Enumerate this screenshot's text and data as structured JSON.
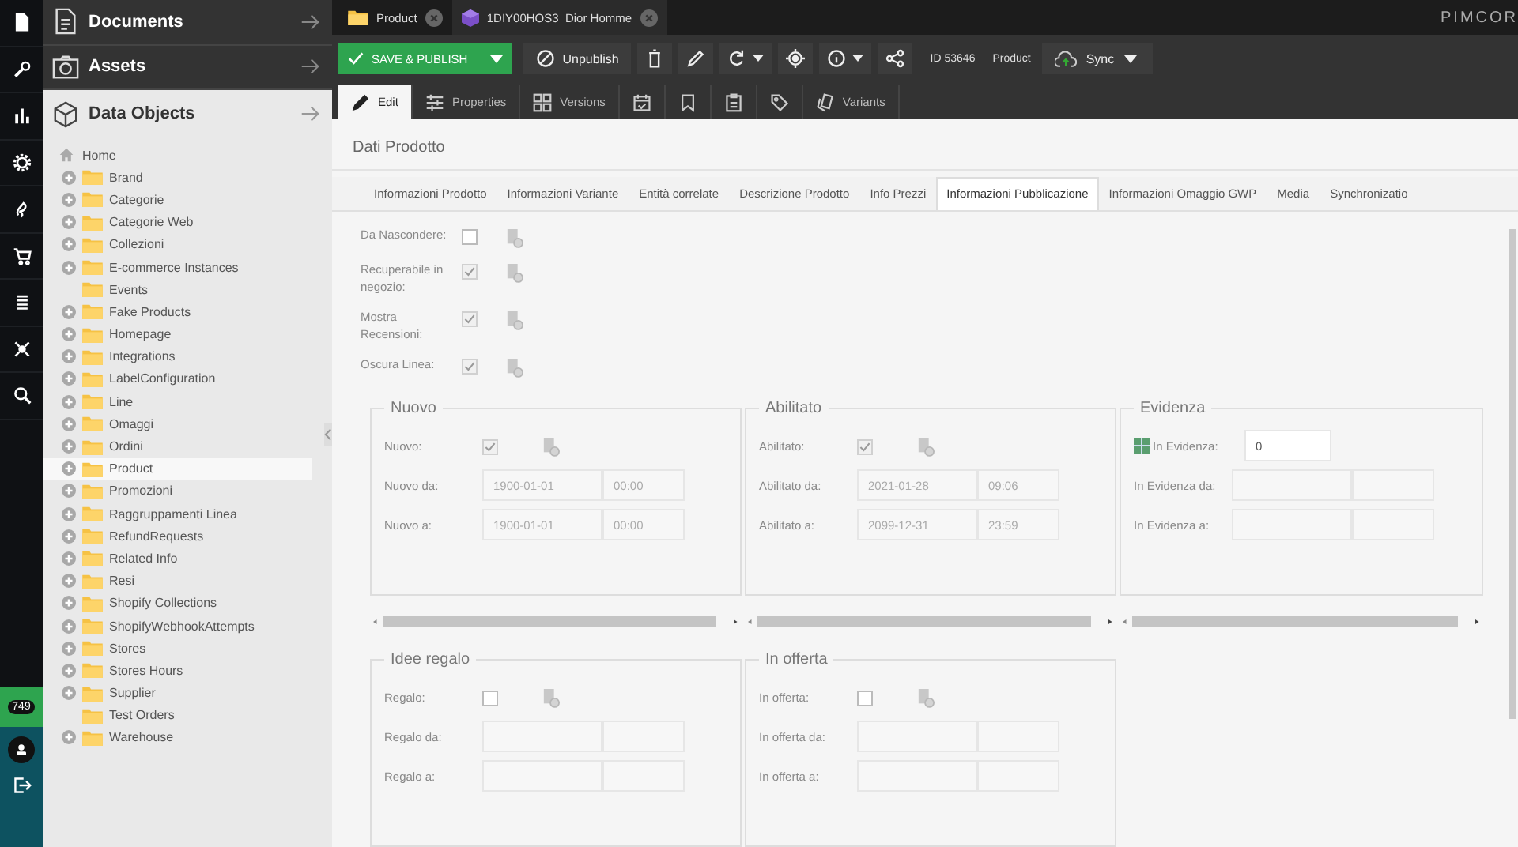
{
  "left_bar": {
    "badge": "749"
  },
  "sidebar": {
    "panels": [
      {
        "title": "Documents",
        "expanded": false
      },
      {
        "title": "Assets",
        "expanded": false
      },
      {
        "title": "Data Objects",
        "expanded": true
      }
    ],
    "tree": {
      "label": "Home",
      "children": [
        {
          "label": "Brand",
          "expandable": true,
          "selected": false
        },
        {
          "label": "Categorie",
          "expandable": true,
          "selected": false
        },
        {
          "label": "Categorie Web",
          "expandable": true,
          "selected": false
        },
        {
          "label": "Collezioni",
          "expandable": true,
          "selected": false
        },
        {
          "label": "E-commerce Instances",
          "expandable": true,
          "selected": false
        },
        {
          "label": "Events",
          "expandable": false,
          "selected": false
        },
        {
          "label": "Fake Products",
          "expandable": true,
          "selected": false
        },
        {
          "label": "Homepage",
          "expandable": true,
          "selected": false
        },
        {
          "label": "Integrations",
          "expandable": true,
          "selected": false
        },
        {
          "label": "LabelConfiguration",
          "expandable": true,
          "selected": false
        },
        {
          "label": "Line",
          "expandable": true,
          "selected": false
        },
        {
          "label": "Omaggi",
          "expandable": true,
          "selected": false
        },
        {
          "label": "Ordini",
          "expandable": true,
          "selected": false
        },
        {
          "label": "Product",
          "expandable": true,
          "selected": true
        },
        {
          "label": "Promozioni",
          "expandable": true,
          "selected": false
        },
        {
          "label": "Raggruppamenti Linea",
          "expandable": true,
          "selected": false
        },
        {
          "label": "RefundRequests",
          "expandable": true,
          "selected": false
        },
        {
          "label": "Related Info",
          "expandable": true,
          "selected": false
        },
        {
          "label": "Resi",
          "expandable": true,
          "selected": false
        },
        {
          "label": "Shopify Collections",
          "expandable": true,
          "selected": false
        },
        {
          "label": "ShopifyWebhookAttempts",
          "expandable": true,
          "selected": false
        },
        {
          "label": "Stores",
          "expandable": true,
          "selected": false
        },
        {
          "label": "Stores Hours",
          "expandable": true,
          "selected": false
        },
        {
          "label": "Supplier",
          "expandable": true,
          "selected": false
        },
        {
          "label": "Test Orders",
          "expandable": false,
          "selected": false
        },
        {
          "label": "Warehouse",
          "expandable": true,
          "selected": false
        }
      ]
    }
  },
  "editor_tabs": [
    {
      "label": "Product",
      "kind": "folder",
      "selected": false
    },
    {
      "label": "1DIY00HOS3_Dior Homme",
      "kind": "object",
      "selected": true
    }
  ],
  "logo": "PIMCOR",
  "toolbar": {
    "save_label": "SAVE & PUBLISH",
    "unpublish_label": "Unpublish",
    "id": "ID 53646",
    "type": "Product",
    "sync_label": "Sync"
  },
  "view_tabs": [
    {
      "label": "Edit",
      "selected": true
    },
    {
      "label": "Properties",
      "selected": false
    },
    {
      "label": "Versions",
      "selected": false
    },
    {
      "selected": false
    },
    {
      "selected": false
    },
    {
      "selected": false
    },
    {
      "selected": false
    },
    {
      "label": "Variants",
      "selected": false
    }
  ],
  "panel_title": "Dati Prodotto",
  "form_tabs": [
    {
      "label": "Informazioni Prodotto",
      "selected": false
    },
    {
      "label": "Informazioni Variante",
      "selected": false
    },
    {
      "label": "Entità correlate",
      "selected": false
    },
    {
      "label": "Descrizione Prodotto",
      "selected": false
    },
    {
      "label": "Info Prezzi",
      "selected": false
    },
    {
      "label": "Informazioni Pubblicazione",
      "selected": true
    },
    {
      "label": "Informazioni Omaggio GWP",
      "selected": false
    },
    {
      "label": "Media",
      "selected": false
    },
    {
      "label": "Synchronizatio",
      "selected": false
    }
  ],
  "flags": [
    {
      "label": "Da Nascondere:",
      "checked": false
    },
    {
      "label": "Recuperabile in negozio:",
      "checked": true
    },
    {
      "label": "Mostra Recensioni:",
      "checked": true
    },
    {
      "label": "Oscura Linea:",
      "checked": true
    }
  ],
  "fieldset_rows": [
    [
      {
        "title": "Nuovo",
        "rows": [
          {
            "kind": "checkbox",
            "label": "Nuovo:",
            "checked": true
          },
          {
            "kind": "datetime",
            "label": "Nuovo da:",
            "date": "1900-01-01",
            "time": "00:00"
          },
          {
            "kind": "datetime",
            "label": "Nuovo a:",
            "date": "1900-01-01",
            "time": "00:00"
          }
        ]
      },
      {
        "title": "Abilitato",
        "rows": [
          {
            "kind": "checkbox",
            "label": "Abilitato:",
            "checked": true
          },
          {
            "kind": "datetime",
            "label": "Abilitato da:",
            "date": "2021-01-28",
            "time": "09:06"
          },
          {
            "kind": "datetime",
            "label": "Abilitato a:",
            "date": "2099-12-31",
            "time": "23:59"
          }
        ]
      },
      {
        "title": "Evidenza",
        "rows": [
          {
            "kind": "number",
            "label": "In Evidenza:",
            "value": "0"
          },
          {
            "kind": "datetime",
            "label": "In Evidenza da:"
          },
          {
            "kind": "datetime",
            "label": "In Evidenza a:"
          }
        ]
      }
    ],
    [
      {
        "title": "Idee regalo",
        "rows": [
          {
            "kind": "checkbox",
            "label": "Regalo:",
            "checked": false
          },
          {
            "kind": "datetime",
            "label": "Regalo da:"
          },
          {
            "kind": "datetime",
            "label": "Regalo a:"
          }
        ]
      },
      {
        "title": "In offerta",
        "rows": [
          {
            "kind": "checkbox",
            "label": "In offerta:",
            "checked": false
          },
          {
            "kind": "datetime",
            "label": "In offerta da:"
          },
          {
            "kind": "datetime",
            "label": "In offerta a:"
          }
        ]
      }
    ]
  ]
}
